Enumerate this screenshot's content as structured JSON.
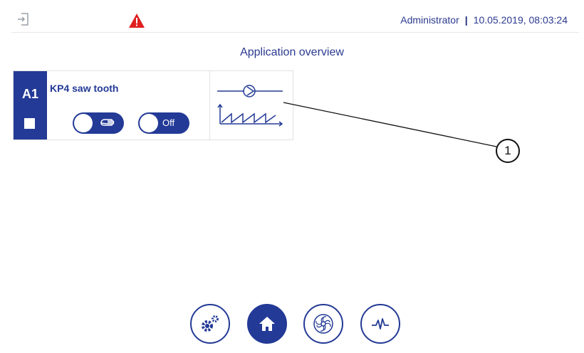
{
  "header": {
    "user": "Administrator",
    "datetime": "10.05.2019, 08:03:24",
    "login_icon": "login-icon",
    "alert_icon": "warning-icon",
    "alert_color": "#e02020"
  },
  "page": {
    "title": "Application overview"
  },
  "application": {
    "id": "A1",
    "name": "KP4 saw tooth",
    "manual_icon": "hand-icon",
    "off_label": "Off",
    "symbol": "pump-sawtooth-icon"
  },
  "callout": {
    "number": "1"
  },
  "nav": [
    {
      "name": "settings",
      "icon": "gears-icon"
    },
    {
      "name": "home",
      "icon": "home-icon",
      "active": true
    },
    {
      "name": "pump",
      "icon": "fan-icon"
    },
    {
      "name": "trend",
      "icon": "waveform-icon"
    }
  ],
  "colors": {
    "primary": "#233a96",
    "text": "#2b3a8f"
  }
}
